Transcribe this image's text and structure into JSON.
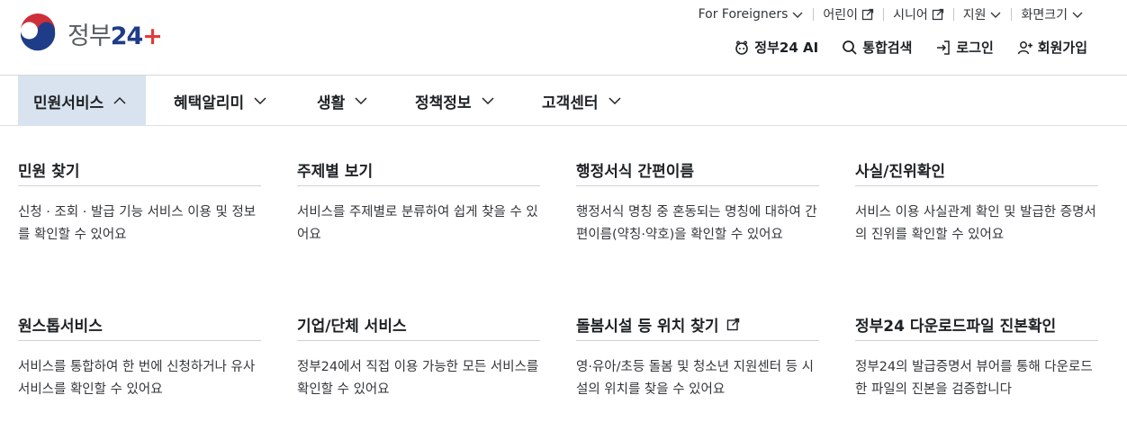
{
  "logo": {
    "text_prefix": "정부",
    "text_number": "24"
  },
  "util_nav": [
    {
      "label": "For Foreigners",
      "icon": "chevron-down-icon"
    },
    {
      "label": "어린이",
      "icon": "external-link-icon"
    },
    {
      "label": "시니어",
      "icon": "external-link-icon"
    },
    {
      "label": "지원",
      "icon": "chevron-down-icon"
    },
    {
      "label": "화면크기",
      "icon": "chevron-down-icon"
    }
  ],
  "actions": [
    {
      "label": "정부24 AI",
      "icon": "ai-icon"
    },
    {
      "label": "통합검색",
      "icon": "search-icon"
    },
    {
      "label": "로그인",
      "icon": "login-icon"
    },
    {
      "label": "회원가입",
      "icon": "user-plus-icon"
    }
  ],
  "gnb": [
    {
      "label": "민원서비스",
      "active": true
    },
    {
      "label": "혜택알리미",
      "active": false
    },
    {
      "label": "생활",
      "active": false
    },
    {
      "label": "정책정보",
      "active": false
    },
    {
      "label": "고객센터",
      "active": false
    }
  ],
  "menu": [
    {
      "title": "민원 찾기",
      "desc": "신청 · 조회 · 발급 기능 서비스 이용 및 정보를 확인할 수 있어요"
    },
    {
      "title": "주제별 보기",
      "desc": "서비스를 주제별로 분류하여 쉽게 찾을 수 있어요"
    },
    {
      "title": "행정서식 간편이름",
      "desc": "행정서식 명칭 중 혼동되는 명칭에 대하여 간편이름(약칭·약호)을 확인할 수 있어요"
    },
    {
      "title": "사실/진위확인",
      "desc": "서비스 이용 사실관계 확인 및 발급한 증명서의 진위를 확인할 수 있어요"
    },
    {
      "title": "원스톱서비스",
      "desc": "서비스를 통합하여 한 번에 신청하거나 유사 서비스를 확인할 수 있어요"
    },
    {
      "title": "기업/단체 서비스",
      "desc": "정부24에서 직접 이용 가능한 모든 서비스를 확인할 수 있어요"
    },
    {
      "title": "돌봄시설 등 위치 찾기",
      "desc": "영·유아/초등 돌봄 및 청소년 지원센터 등 시설의 위치를 찾을 수 있어요",
      "external": true
    },
    {
      "title": "정부24 다운로드파일 진본확인",
      "desc": "정부24의 발급증명서 뷰어를 통해 다운로드한 파일의 진본을 검증합니다"
    }
  ]
}
